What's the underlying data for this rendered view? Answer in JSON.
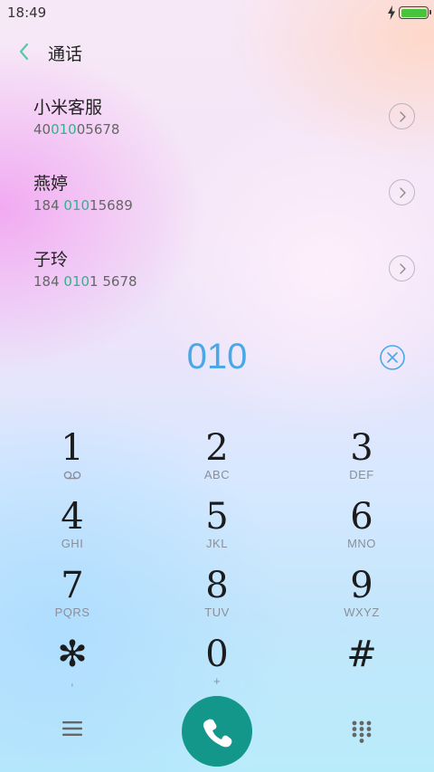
{
  "status_bar": {
    "time": "18:49",
    "icons": [
      "bolt-icon",
      "battery-icon"
    ],
    "battery_color": "#49c23c"
  },
  "header": {
    "title": "通话",
    "back_icon": "chevron-left-icon"
  },
  "results": [
    {
      "name": "小米客服",
      "number_pre": "40",
      "number_match": "010",
      "number_post": "05678"
    },
    {
      "name": "燕婷",
      "number_pre": "184 ",
      "number_match": "010",
      "number_post": "15689"
    },
    {
      "name": "子玲",
      "number_pre": "184 ",
      "number_match": "010",
      "number_post": "1 5678"
    }
  ],
  "dial_input": {
    "value": "010",
    "delete_icon": "circle-x-icon"
  },
  "keypad": [
    {
      "digit": "1",
      "letters": "",
      "icon": "voicemail-icon"
    },
    {
      "digit": "2",
      "letters": "ABC"
    },
    {
      "digit": "3",
      "letters": "DEF"
    },
    {
      "digit": "4",
      "letters": "GHI"
    },
    {
      "digit": "5",
      "letters": "JKL"
    },
    {
      "digit": "6",
      "letters": "MNO"
    },
    {
      "digit": "7",
      "letters": "PQRS"
    },
    {
      "digit": "8",
      "letters": "TUV"
    },
    {
      "digit": "9",
      "letters": "WXYZ"
    },
    {
      "digit": "✻",
      "letters": ","
    },
    {
      "digit": "0",
      "letters": "+"
    },
    {
      "digit": "#",
      "letters": ""
    }
  ],
  "bottom_bar": {
    "menu_icon": "menu-icon",
    "call_icon": "phone-icon",
    "keypad_icon": "dialpad-icon"
  },
  "colors": {
    "accent_blue": "#4aa8e8",
    "match_green": "#2fb38a",
    "call_button": "#13978a"
  }
}
